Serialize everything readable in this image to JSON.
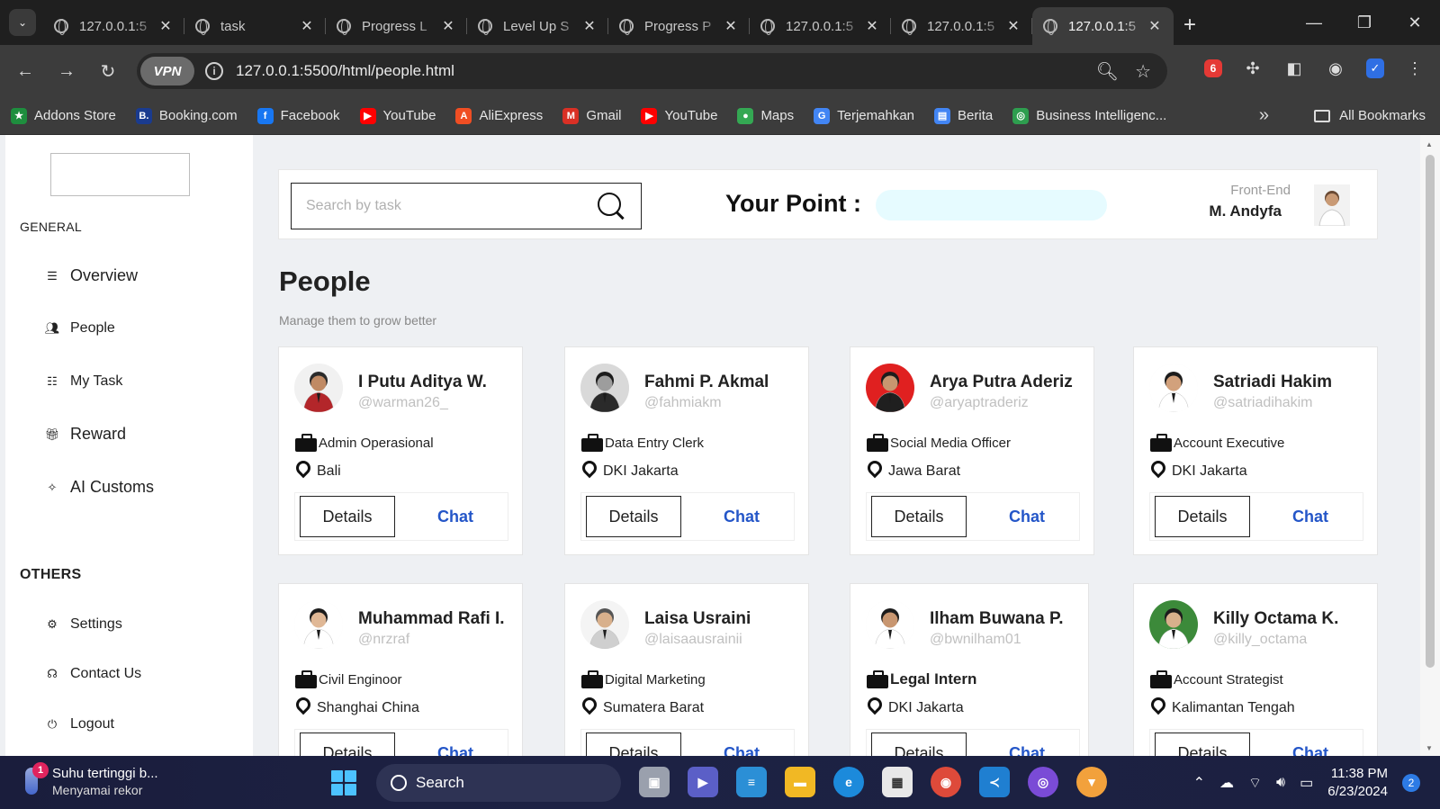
{
  "browser": {
    "tabs": [
      {
        "title": "127.0.0.1:5",
        "active": false
      },
      {
        "title": "task",
        "active": false
      },
      {
        "title": "Progress L",
        "active": false
      },
      {
        "title": "Level Up S",
        "active": false
      },
      {
        "title": "Progress P",
        "active": false
      },
      {
        "title": "127.0.0.1:5",
        "active": false
      },
      {
        "title": "127.0.0.1:5",
        "active": false
      },
      {
        "title": "127.0.0.1:5",
        "active": true
      }
    ],
    "vpn_label": "VPN",
    "url": "127.0.0.1:5500/html/people.html",
    "bookmarks": [
      {
        "label": "Addons Store",
        "color": "#1e8e3e",
        "glyph": "★"
      },
      {
        "label": "Booking.com",
        "color": "#1a3b8f",
        "glyph": "B."
      },
      {
        "label": "Facebook",
        "color": "#1877f2",
        "glyph": "f"
      },
      {
        "label": "YouTube",
        "color": "#ff0000",
        "glyph": "▶"
      },
      {
        "label": "AliExpress",
        "color": "#f04e23",
        "glyph": "A"
      },
      {
        "label": "Gmail",
        "color": "#d93025",
        "glyph": "M"
      },
      {
        "label": "YouTube",
        "color": "#ff0000",
        "glyph": "▶"
      },
      {
        "label": "Maps",
        "color": "#34a853",
        "glyph": "●"
      },
      {
        "label": "Terjemahkan",
        "color": "#4285f4",
        "glyph": "G"
      },
      {
        "label": "Berita",
        "color": "#4285f4",
        "glyph": "▤"
      },
      {
        "label": "Business Intelligenc...",
        "color": "#2e9e4f",
        "glyph": "◎"
      }
    ],
    "all_bookmarks": "All Bookmarks"
  },
  "sidebar": {
    "general_heading": "GENERAL",
    "general_items": [
      {
        "label": "Overview",
        "icon": "overview-icon"
      },
      {
        "label": "People",
        "icon": "people-icon"
      },
      {
        "label": "My Task",
        "icon": "task-list-icon"
      },
      {
        "label": "Reward",
        "icon": "gift-icon"
      },
      {
        "label": "AI Customs",
        "icon": "ai-icon"
      }
    ],
    "others_heading": "OTHERS",
    "other_items": [
      {
        "label": "Settings",
        "icon": "gear-icon"
      },
      {
        "label": "Contact Us",
        "icon": "headset-icon"
      },
      {
        "label": "Logout",
        "icon": "logout-icon"
      }
    ]
  },
  "header": {
    "search_placeholder": "Search by task",
    "points_label": "Your Point :",
    "points_progress": 0,
    "user_role": "Front-End",
    "user_name": "M. Andyfa"
  },
  "main": {
    "title": "People",
    "subtitle": "Manage them to grow better",
    "people": [
      {
        "name": "I Putu Aditya W.",
        "handle": "@warman26_",
        "role": "Admin Operasional",
        "location": "Bali"
      },
      {
        "name": "Fahmi P. Akmal",
        "handle": "@fahmiakm",
        "role": "Data Entry Clerk",
        "location": "DKI Jakarta"
      },
      {
        "name": "Arya Putra Aderiz",
        "handle": "@aryaptraderiz",
        "role": "Social Media Officer",
        "location": "Jawa Barat"
      },
      {
        "name": "Satriadi Hakim",
        "handle": "@satriadihakim",
        "role": "Account Executive",
        "location": "DKI Jakarta"
      },
      {
        "name": "Muhammad Rafi I.",
        "handle": "@nrzraf",
        "role": "Civil Enginoor",
        "location": "Shanghai China"
      },
      {
        "name": "Laisa Usraini",
        "handle": "@laisaausrainii",
        "role": "Digital Marketing",
        "location": "Sumatera Barat"
      },
      {
        "name": "Ilham Buwana P.",
        "handle": "@bwnilham01",
        "role": "Legal Intern",
        "location": "DKI Jakarta"
      },
      {
        "name": "Killy Octama K.",
        "handle": "@killy_octama",
        "role": "Account Strategist",
        "location": "Kalimantan Tengah"
      }
    ],
    "details_label": "Details",
    "chat_label": "Chat"
  },
  "taskbar": {
    "notification_count": "1",
    "weather_title": "Suhu tertinggi b...",
    "weather_sub": "Menyamai rekor",
    "search_label": "Search",
    "time": "11:38 PM",
    "date": "6/23/2024",
    "tray_badge": "2"
  }
}
